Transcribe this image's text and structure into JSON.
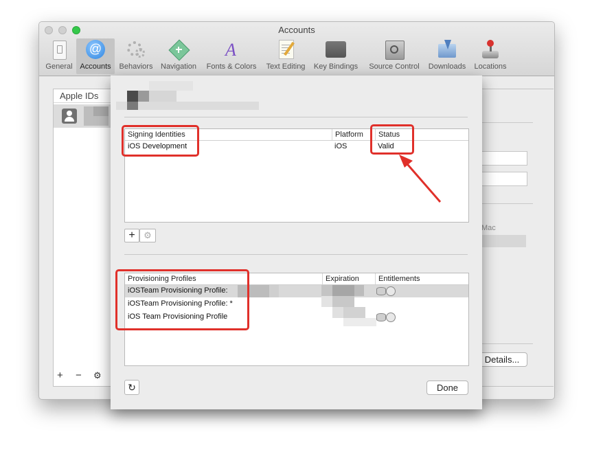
{
  "window": {
    "title": "Accounts"
  },
  "toolbar": {
    "items": [
      {
        "label": "General",
        "icon": "general-icon"
      },
      {
        "label": "Accounts",
        "icon": "at-sign-icon"
      },
      {
        "label": "Behaviors",
        "icon": "gears-icon"
      },
      {
        "label": "Navigation",
        "icon": "navigation-icon"
      },
      {
        "label": "Fonts & Colors",
        "icon": "fonts-colors-icon"
      },
      {
        "label": "Text Editing",
        "icon": "text-editing-icon"
      },
      {
        "label": "Key Bindings",
        "icon": "keyboard-icon"
      },
      {
        "label": "Source Control",
        "icon": "source-control-icon"
      },
      {
        "label": "Downloads",
        "icon": "downloads-icon"
      },
      {
        "label": "Locations",
        "icon": "joystick-icon"
      }
    ],
    "selected": "Accounts"
  },
  "sidebar": {
    "header": "Apple IDs",
    "footer": {
      "add": "+",
      "remove": "−",
      "settings": "⚙"
    }
  },
  "right_panel": {
    "mac_label": "Mac",
    "details_button": "Details..."
  },
  "sheet": {
    "signing": {
      "columns": [
        "Signing Identities",
        "Platform",
        "Status"
      ],
      "rows": [
        {
          "identity": "iOS Development",
          "platform": "iOS",
          "status": "Valid"
        }
      ],
      "add": "+",
      "settings": "⚙"
    },
    "profiles": {
      "columns": [
        "Provisioning Profiles",
        "Expiration",
        "Entitlements"
      ],
      "rows": [
        {
          "name": "iOSTeam Provisioning Profile:"
        },
        {
          "name": "iOSTeam Provisioning Profile: *"
        },
        {
          "name": "iOS Team Provisioning Profile"
        }
      ]
    },
    "refresh": "↻",
    "done": "Done"
  },
  "colors": {
    "annotation": "#e0302a",
    "accent": "#3b93e6"
  }
}
